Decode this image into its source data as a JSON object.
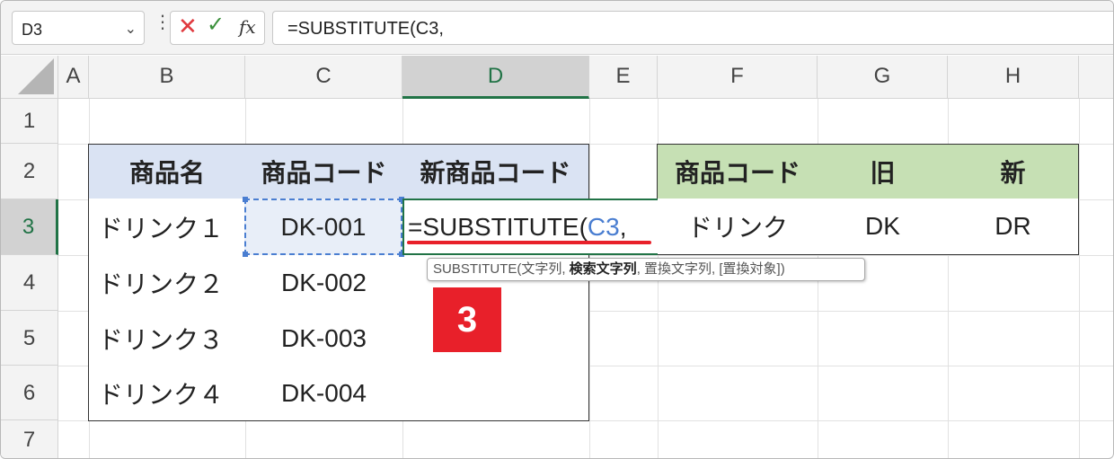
{
  "formula_bar": {
    "name_box": "D3",
    "name_box_arrow": "⌄",
    "dots": "⋮",
    "cancel_glyph": "✕",
    "enter_glyph": "✓",
    "fx_label": "fx",
    "formula": "=SUBSTITUTE(C3,"
  },
  "columns": [
    "A",
    "B",
    "C",
    "D",
    "E",
    "F",
    "G",
    "H"
  ],
  "rows": [
    "1",
    "2",
    "3",
    "4",
    "5",
    "6",
    "7"
  ],
  "table1": {
    "headers": [
      "商品名",
      "商品コード",
      "新商品コード"
    ],
    "rows": [
      [
        "ドリンク１",
        "DK-001",
        ""
      ],
      [
        "ドリンク２",
        "DK-002",
        ""
      ],
      [
        "ドリンク３",
        "DK-003",
        ""
      ],
      [
        "ドリンク４",
        "DK-004",
        ""
      ]
    ]
  },
  "table2": {
    "headers": [
      "商品コード",
      "旧",
      "新"
    ],
    "row": [
      "ドリンク",
      "DK",
      "DR"
    ]
  },
  "edit_cell": {
    "prefix": "=SUBSTITUTE(",
    "ref": "C3",
    "suffix": ","
  },
  "tooltip": {
    "func": "SUBSTITUTE(文字列, ",
    "current_arg": "検索文字列",
    "rest": ", 置換文字列, [置換対象])"
  },
  "step_badge": "3",
  "colors": {
    "header_blue": "#dae3f3",
    "header_green": "#c6e0b4",
    "excel_green": "#217346",
    "ref_blue": "#4a7ed1",
    "annotation_red": "#e8202a"
  }
}
